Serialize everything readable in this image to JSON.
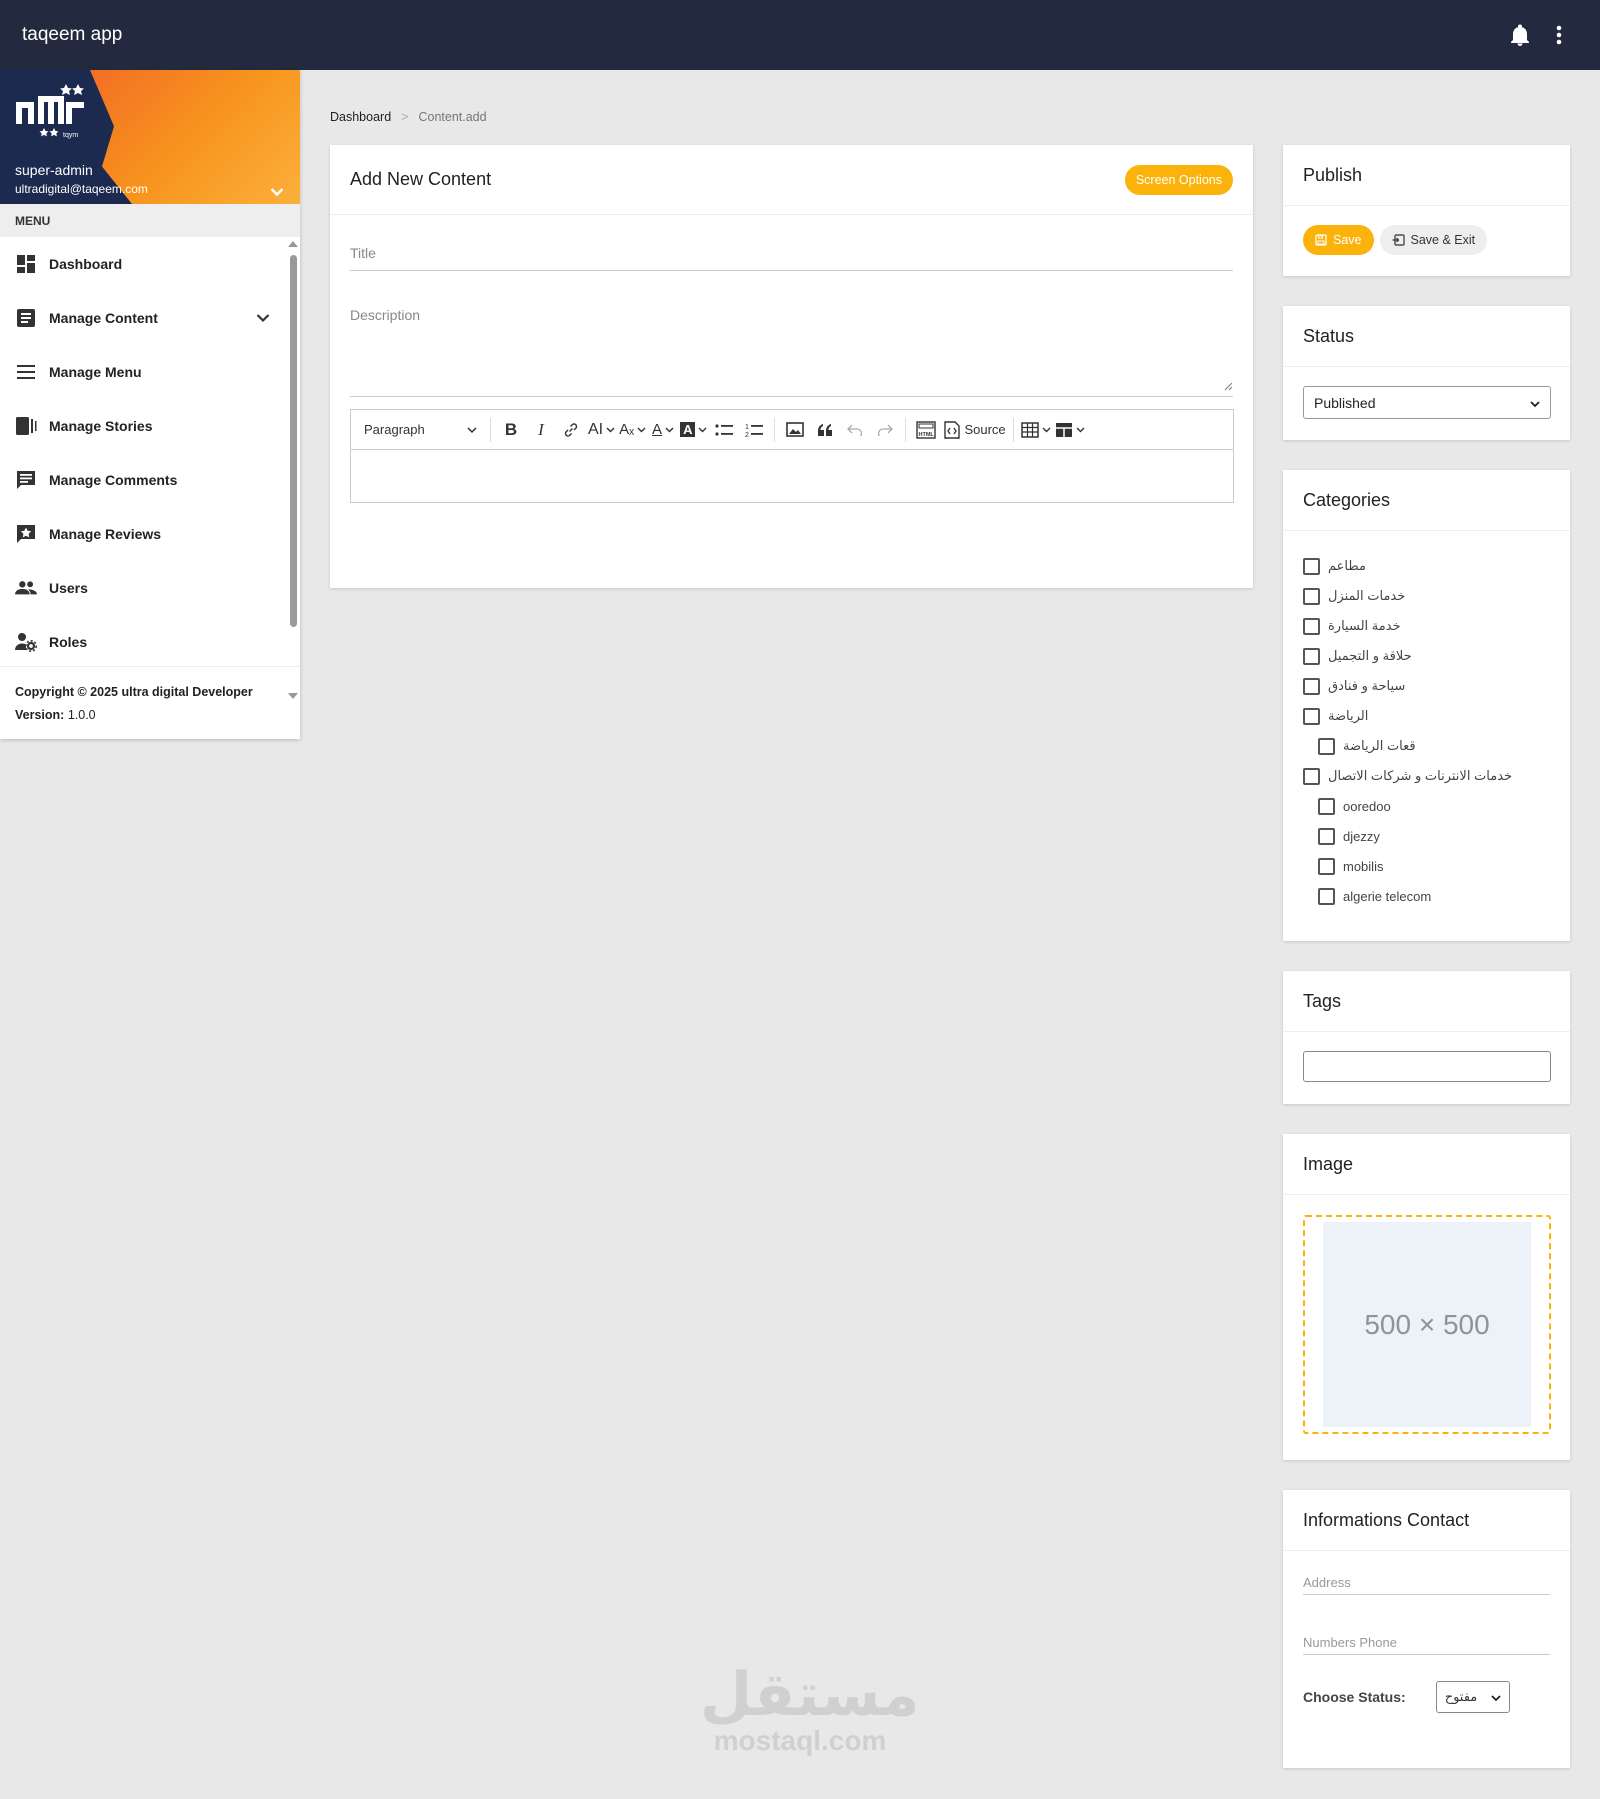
{
  "topbar": {
    "title": "taqeem app"
  },
  "profile": {
    "name": "super-admin",
    "email": "ultradigital@taqeem.com",
    "logo_text": "tqym"
  },
  "sidebar": {
    "menu_label": "MENU",
    "items": [
      {
        "label": "Dashboard",
        "icon": "dashboard-icon"
      },
      {
        "label": "Manage Content",
        "icon": "article-icon"
      },
      {
        "label": "Manage Menu",
        "icon": "menu-icon"
      },
      {
        "label": "Manage Stories",
        "icon": "stories-icon"
      },
      {
        "label": "Manage Comments",
        "icon": "comment-icon"
      },
      {
        "label": "Manage Reviews",
        "icon": "review-icon"
      },
      {
        "label": "Users",
        "icon": "users-icon"
      },
      {
        "label": "Roles",
        "icon": "roles-icon"
      }
    ],
    "copyright": "Copyright © 2025 ultra digital Developer",
    "version_label": "Version:",
    "version": "1.0.0"
  },
  "breadcrumb": {
    "home": "Dashboard",
    "sep": ">",
    "current": "Content.add"
  },
  "content": {
    "heading": "Add New Content",
    "screen_options": "Screen Options",
    "title_placeholder": "Title",
    "description_placeholder": "Description",
    "editor": {
      "paragraph": "Paragraph",
      "source": "Source"
    }
  },
  "publish": {
    "heading": "Publish",
    "save": "Save",
    "save_exit": "Save & Exit"
  },
  "status": {
    "heading": "Status",
    "selected": "Published"
  },
  "categories": {
    "heading": "Categories",
    "items": [
      {
        "label": "مطاعم"
      },
      {
        "label": "خدمات المنزل"
      },
      {
        "label": "خدمة السيارة"
      },
      {
        "label": "حلاقة و التجميل"
      },
      {
        "label": "سياحة و فنادق"
      },
      {
        "label": "الرياضة"
      },
      {
        "label": "قعات الرياضة"
      },
      {
        "label": "خدمات الانترنات و شركات الاتصال"
      },
      {
        "label": "ooredoo"
      },
      {
        "label": "djezzy"
      },
      {
        "label": "mobilis"
      },
      {
        "label": "algerie telecom"
      }
    ]
  },
  "tags": {
    "heading": "Tags"
  },
  "image": {
    "heading": "Image",
    "placeholder": "500 × 500"
  },
  "contact": {
    "heading": "Informations Contact",
    "address_placeholder": "Address",
    "phone_placeholder": "Numbers Phone",
    "choose_status_label": "Choose Status:",
    "choose_status_value": "مفتوح"
  },
  "watermark": {
    "arabic": "مستقل",
    "latin": "mostaql.com"
  },
  "colors": {
    "topbar": "#232a3f",
    "accent": "#fbb20b",
    "background": "#e8e8e8"
  }
}
